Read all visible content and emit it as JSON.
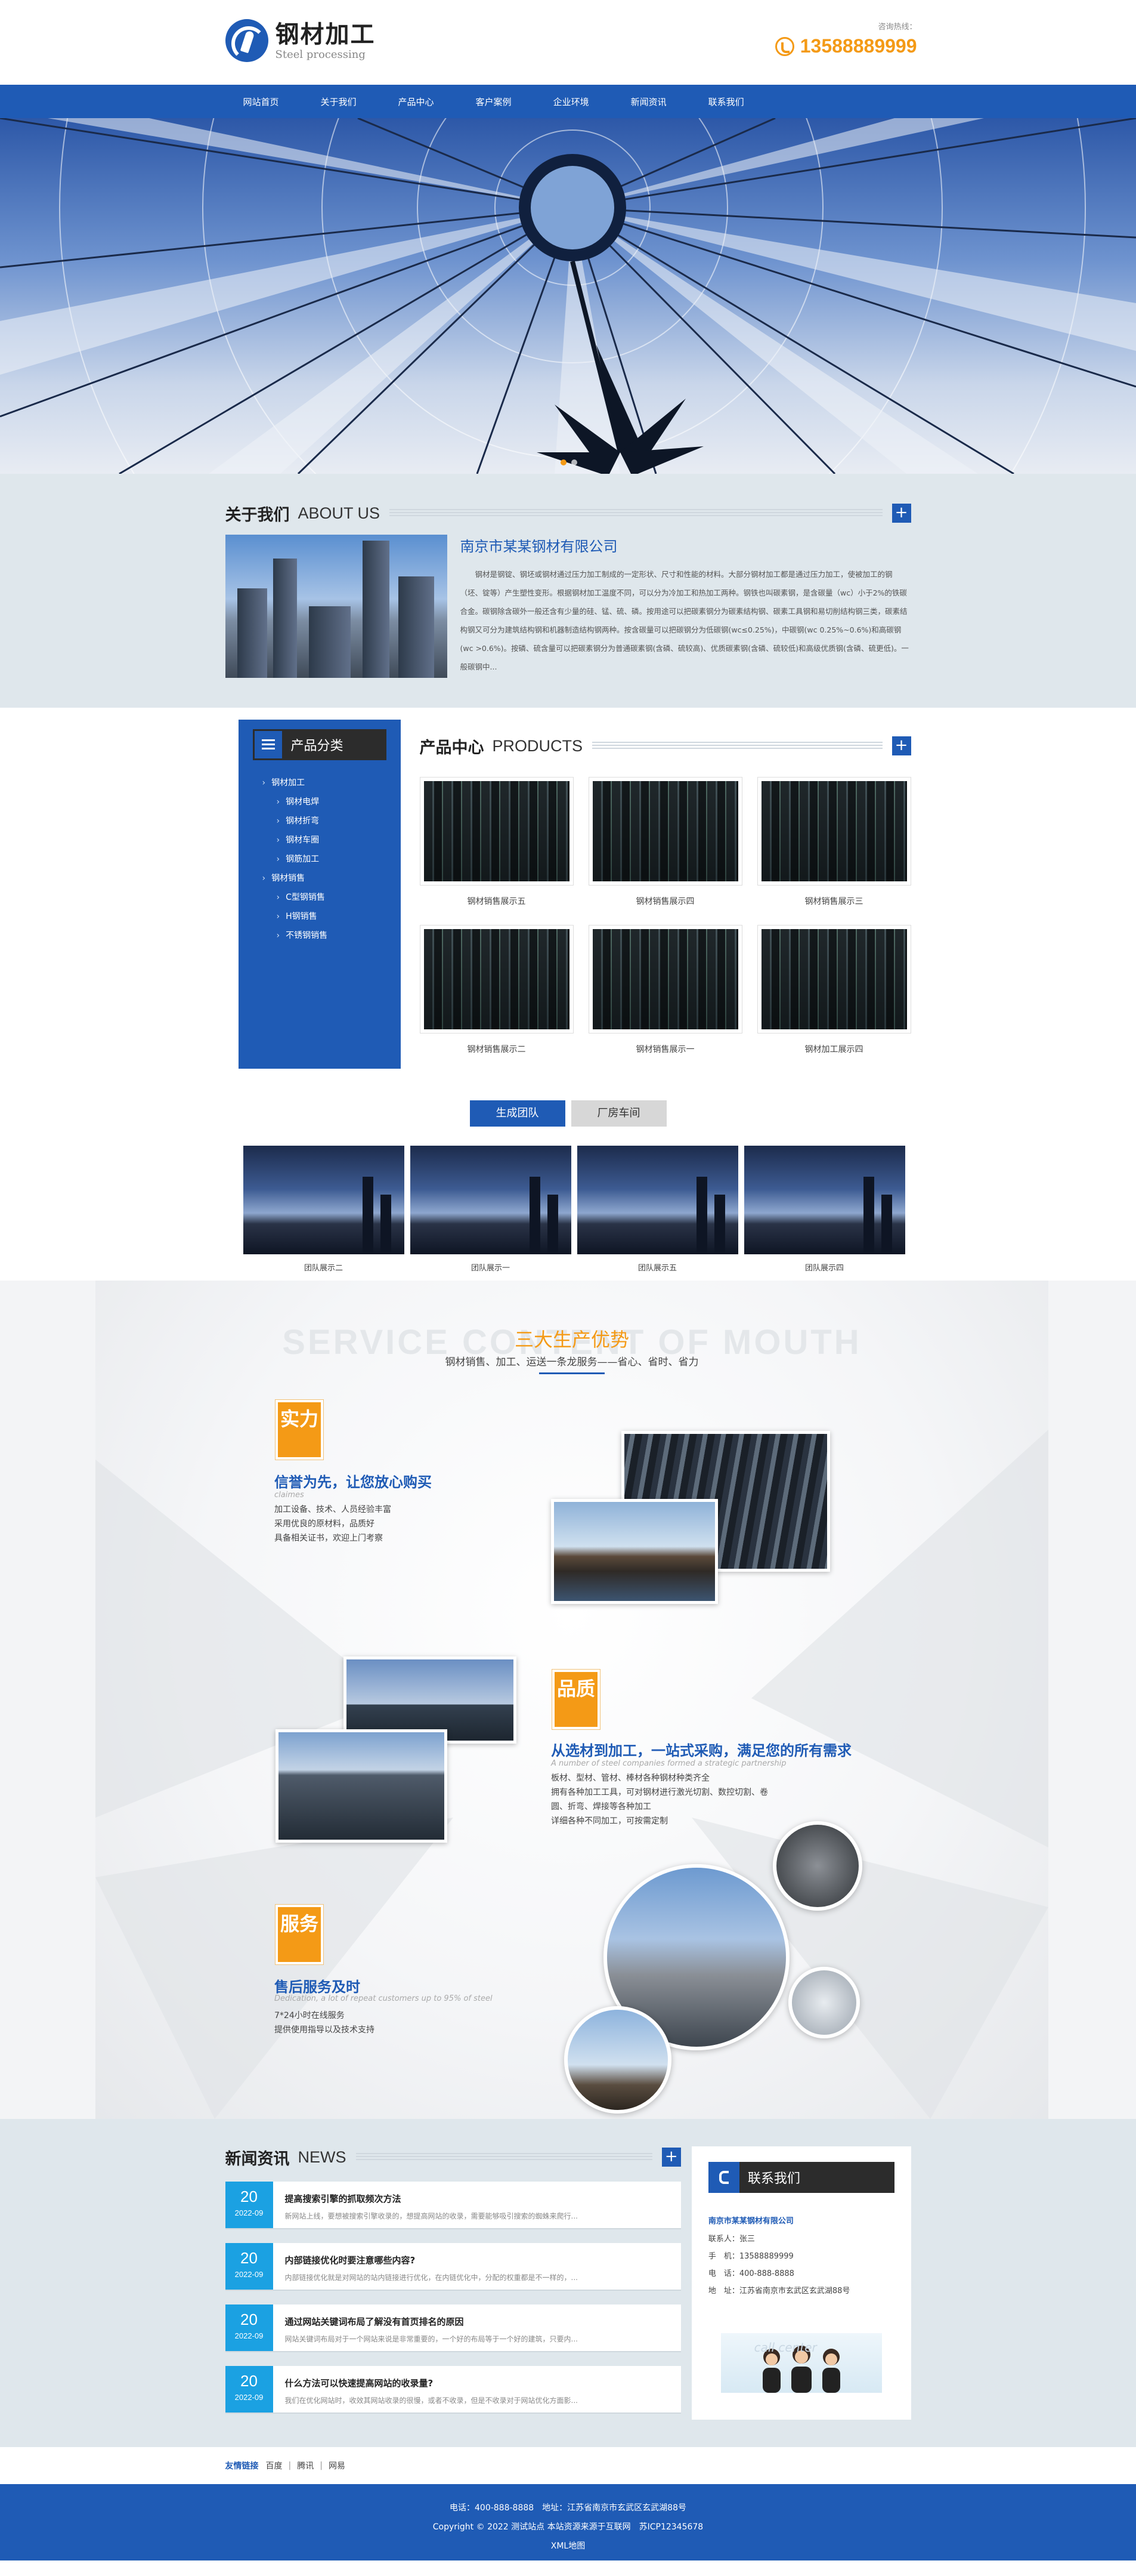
{
  "header": {
    "logo_cn": "钢材加工",
    "logo_en": "Steel processing",
    "hotline_label": "咨询热线：",
    "hotline_number": "13588889999"
  },
  "nav": {
    "items": [
      "网站首页",
      "关于我们",
      "产品中心",
      "客户案例",
      "企业环境",
      "新闻资讯",
      "联系我们"
    ]
  },
  "about": {
    "title_cn": "关于我们",
    "title_en": "ABOUT US",
    "company": "南京市某某钢材有限公司",
    "paragraph": "钢材是钢锭、钢坯或钢材通过压力加工制成的一定形状、尺寸和性能的材料。大部分钢材加工都是通过压力加工，使被加工的钢（坯、锭等）产生塑性变形。根据钢材加工温度不同，可以分为冷加工和热加工两种。钢铁也叫碳素钢，是含碳量（wc）小于2%的铁碳合金。碳钢除含碳外一般还含有少量的硅、锰、硫、磷。按用途可以把碳素钢分为碳素结构钢、碳素工具钢和易切削结构钢三类，碳素结构钢又可分为建筑结构钢和机器制造结构钢两种。按含碳量可以把碳钢分为低碳钢(wc≤0.25%)，中碳钢(wc 0.25%~0.6%)和高碳钢(wc >0.6%)。按磷、硫含量可以把碳素钢分为普通碳素钢(含磷、硫较高)、优质碳素钢(含磷、硫较低)和高级优质钢(含磷、硫更低)。一般碳钢中..."
  },
  "products": {
    "sidebar_title": "产品分类",
    "categories": [
      {
        "label": "钢材加工",
        "level": "top"
      },
      {
        "label": "钢材电焊",
        "level": "sub"
      },
      {
        "label": "钢材折弯",
        "level": "sub"
      },
      {
        "label": "钢材车圈",
        "level": "sub"
      },
      {
        "label": "钢筋加工",
        "level": "sub"
      },
      {
        "label": "钢材销售",
        "level": "top"
      },
      {
        "label": "C型钢销售",
        "level": "sub"
      },
      {
        "label": "H钢销售",
        "level": "sub"
      },
      {
        "label": "不锈钢销售",
        "level": "sub"
      }
    ],
    "title_cn": "产品中心",
    "title_en": "PRODUCTS",
    "items": [
      "钢材销售展示五",
      "钢材销售展示四",
      "钢材销售展示三",
      "钢材销售展示二",
      "钢材销售展示一",
      "钢材加工展示四"
    ]
  },
  "team": {
    "tabs": [
      "生成团队",
      "厂房车间"
    ],
    "items": [
      "团队展示二",
      "团队展示一",
      "团队展示五",
      "团队展示四"
    ]
  },
  "advantages": {
    "ghost": "SERVICE CONTENT OF MOUTH",
    "title": "三大生产优势",
    "subtitle": "钢材销售、加工、运送一条龙服务——省心、省时、省力",
    "blocks": [
      {
        "badge": "实力",
        "title": "信誉为先，让您放心购买",
        "en": "claimes",
        "lines": [
          "加工设备、技术、人员经验丰富",
          "采用优良的原材料，品质好",
          "具备相关证书，欢迎上门考察"
        ]
      },
      {
        "badge": "品质",
        "title": "从选材到加工，一站式采购，满足您的所有需求",
        "en": "A number of steel companies formed a strategic partnership",
        "lines": [
          "板材、型材、管材、棒材各种钢材种类齐全",
          "拥有各种加工工具，可对钢材进行激光切割、数控切割、卷",
          "圆、折弯、焊接等各种加工",
          "详细各种不同加工，可按需定制"
        ]
      },
      {
        "badge": "服务",
        "title": "售后服务及时",
        "en": "Dedication, a lot of repeat customers up to 95% of steel",
        "lines": [
          "7*24小时在线服务",
          "提供使用指导以及技术支持"
        ]
      }
    ]
  },
  "news": {
    "title_cn": "新闻资讯",
    "title_en": "NEWS",
    "items": [
      {
        "day": "20",
        "month": "2022-09",
        "title": "提高搜索引擎的抓取频次方法",
        "summary": "新网站上线，要想被搜索引擎收录的，想提高网站的收录，需要能够吸引搜索的蜘蛛来爬行..."
      },
      {
        "day": "20",
        "month": "2022-09",
        "title": "内部链接优化时要注意哪些内容?",
        "summary": "内部链接优化就是对网站的站内链接进行优化，在内链优化中，分配的权重都是不一样的，..."
      },
      {
        "day": "20",
        "month": "2022-09",
        "title": "通过网站关键词布局了解没有首页排名的原因",
        "summary": "网站关键词布局对于一个网站来说是非常重要的，一个好的布局等于一个好的建筑，只要内..."
      },
      {
        "day": "20",
        "month": "2022-09",
        "title": "什么方法可以快速提高网站的收录量?",
        "summary": "我们在优化网站时，收效其网站收录的很慢，或者不收录，但是不收录对于网站优化方面影..."
      }
    ]
  },
  "contact": {
    "title": "联系我们",
    "company": "南京市某某钢材有限公司",
    "lines": [
      "联系人：张三",
      "手　机：13588889999",
      "电　话：400-888-8888",
      "地　址：江苏省南京市玄武区玄武湖88号"
    ],
    "image_text": "call center"
  },
  "friends": {
    "label": "友情链接",
    "links": [
      "百度",
      "腾讯",
      "网易"
    ]
  },
  "footer": {
    "line1": "电话：400-888-8888　地址：江苏省南京市玄武区玄武湖88号",
    "line2": "Copyright © 2022 测试站点 本站资源来源于互联网　苏ICP12345678",
    "line3": "XML地图"
  },
  "colors": {
    "brand": "#1f5bb5",
    "accent": "#f49a16",
    "date": "#1ba1e2"
  }
}
